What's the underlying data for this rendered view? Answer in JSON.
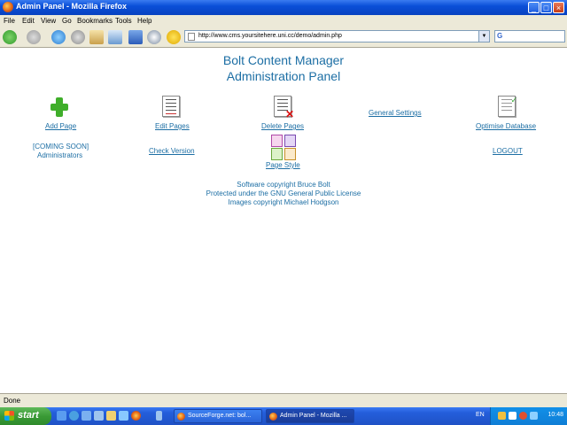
{
  "window": {
    "title": "Admin Panel - Mozilla Firefox"
  },
  "menu": [
    "File",
    "Edit",
    "View",
    "Go",
    "Bookmarks",
    "Tools",
    "Help"
  ],
  "address": {
    "url": "http://www.cms.yoursitehere.uni.cc/demo/admin.php",
    "search_label": "G"
  },
  "page": {
    "title_line1": "Bolt Content Manager",
    "title_line2": "Administration Panel",
    "links": {
      "add_page": "Add Page",
      "edit_pages": "Edit Pages",
      "delete_pages": "Delete Pages",
      "general_settings": "General Settings",
      "optimise_database": "Optimise Database",
      "check_version": "Check Version",
      "page_style": "Page Style",
      "logout": "LOGOUT"
    },
    "administrators_line1": "[COMING SOON]",
    "administrators_line2": "Administrators",
    "copyright": [
      "Software copyright Bruce Bolt",
      "Protected under the GNU General Public License",
      "Images copyright Michael Hodgson"
    ]
  },
  "status": {
    "text": "Done"
  },
  "taskbar": {
    "start": "start",
    "tasks": [
      "SourceForge.net: bol...",
      "Admin Panel - Mozilla ..."
    ],
    "lang": "EN",
    "clock": "10:48"
  }
}
